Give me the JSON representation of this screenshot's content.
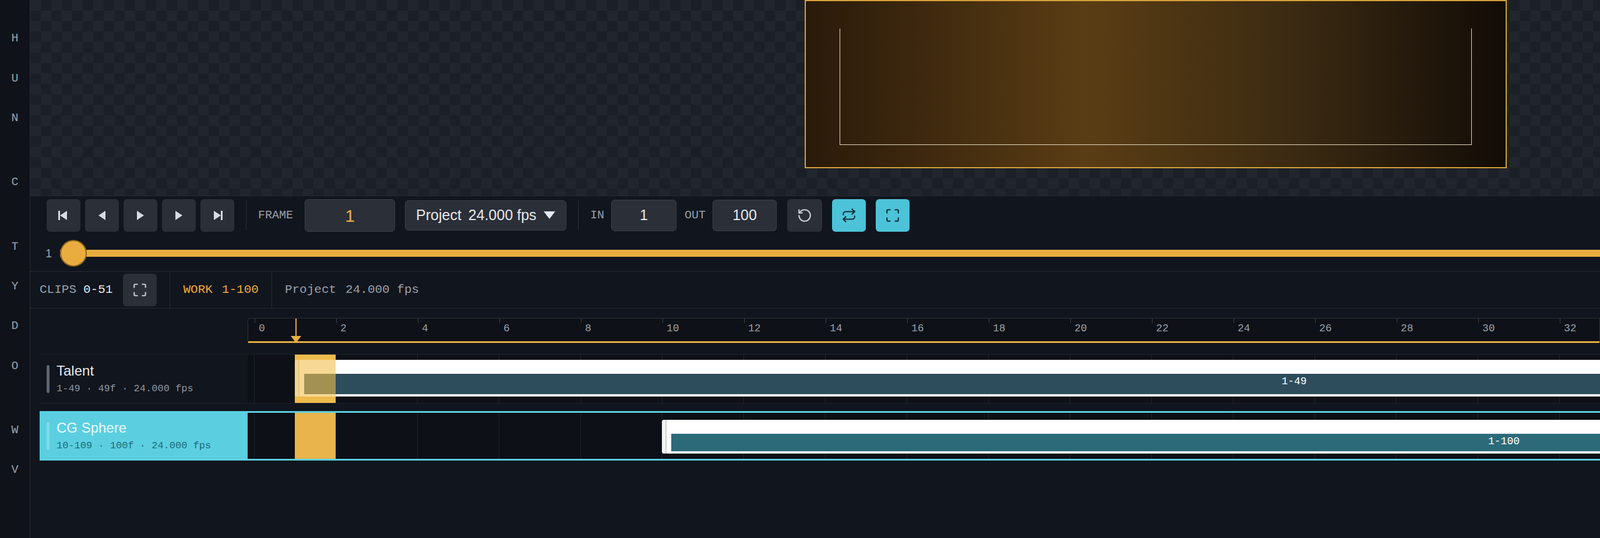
{
  "sidebar": {
    "items": [
      "H",
      "U",
      "N",
      "C",
      "T",
      "Y",
      "D",
      "O",
      "W",
      "V"
    ]
  },
  "transport": {
    "frame": {
      "label": "FRAME",
      "value": "1"
    },
    "rate": {
      "label": "Project",
      "value": "24.000 fps"
    },
    "in": {
      "label": "IN",
      "value": "1"
    },
    "out": {
      "label": "OUT",
      "value": "100"
    },
    "loop": {
      "on": true
    },
    "fit": {
      "on": true
    }
  },
  "scrubber": {
    "label": "1",
    "level": 0
  },
  "info": {
    "clips": {
      "label": "CLIPS",
      "value": "0-51"
    },
    "work": {
      "label": "WORK",
      "value": "1-100"
    },
    "rate": {
      "label": "Project",
      "value": "24.000 fps"
    }
  },
  "ruler": {
    "ticks": [
      "0",
      "2",
      "4",
      "6",
      "8",
      "10",
      "12",
      "14",
      "16",
      "18",
      "20",
      "22",
      "24",
      "26",
      "28",
      "30",
      "32"
    ],
    "playhead": 1
  },
  "tracks": [
    {
      "name": "Talent",
      "info": "1-49 · 49f · 24.000 fps",
      "selected": false,
      "clip": {
        "label": "1-49",
        "start": 1,
        "frames": 49
      }
    },
    {
      "name": "CG Sphere",
      "info": "10-109 · 100f · 24.000 fps",
      "selected": true,
      "clip": {
        "label": "1-100",
        "start": 10,
        "frames": 100
      }
    }
  ]
}
